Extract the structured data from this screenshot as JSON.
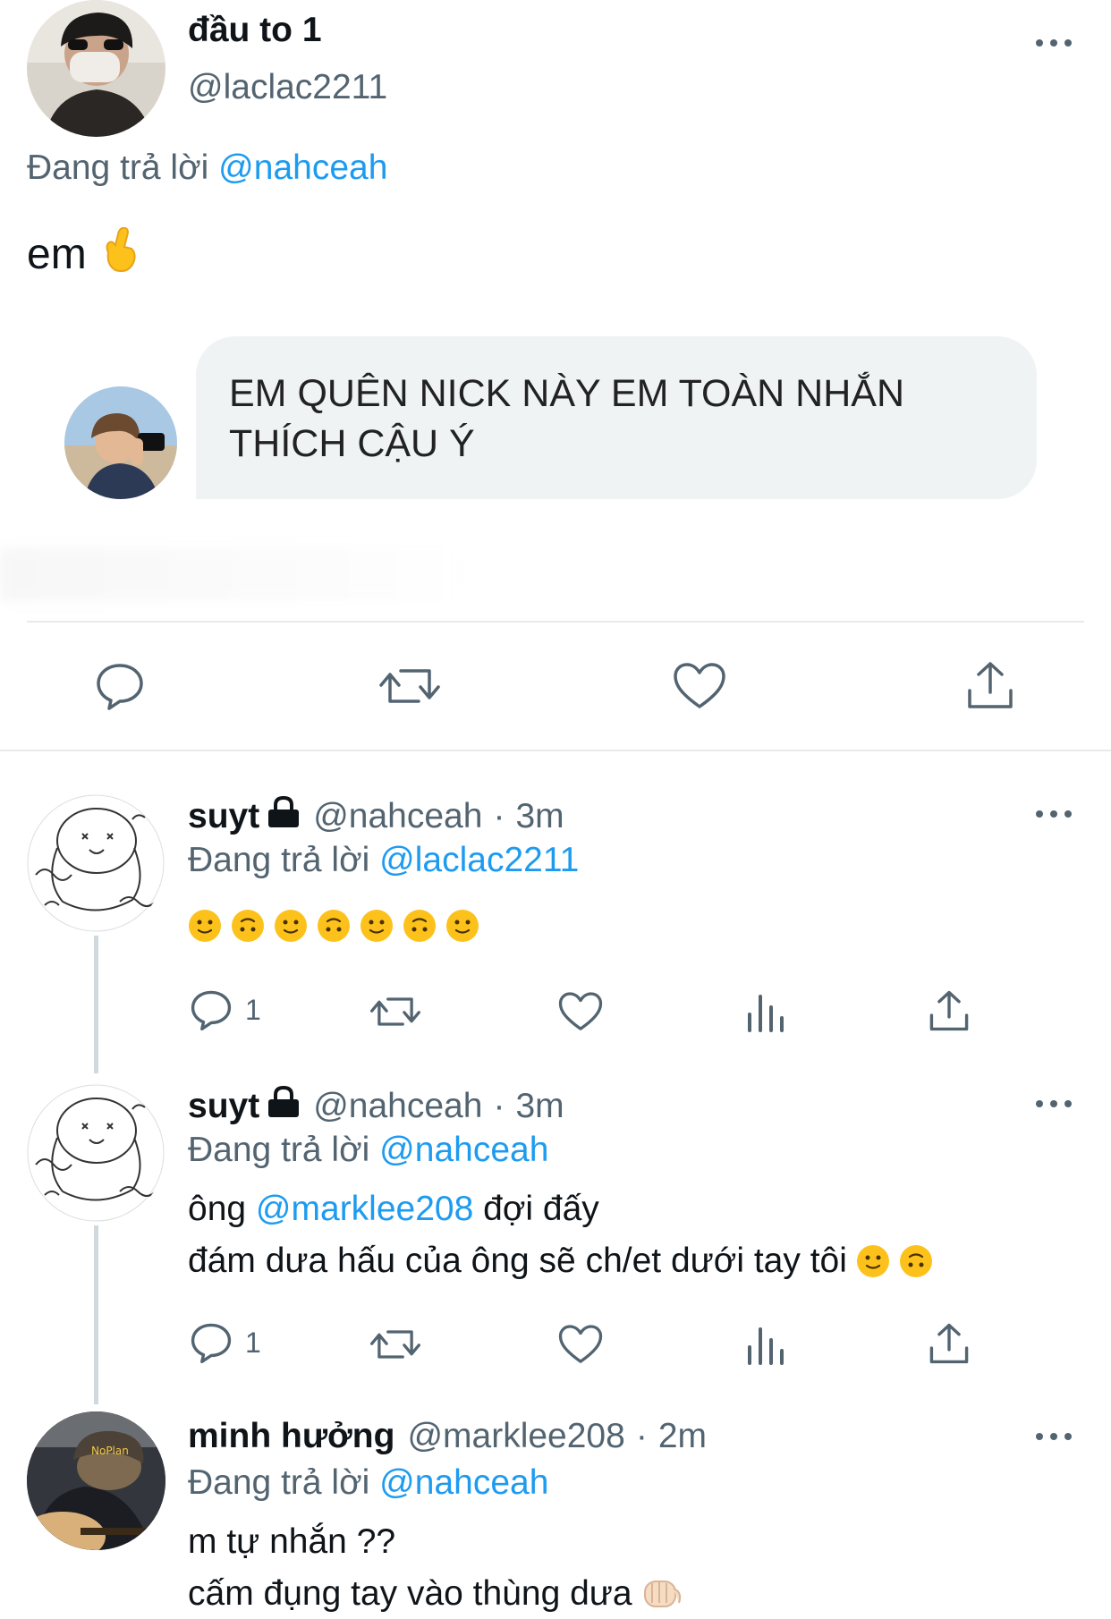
{
  "main_tweet": {
    "name": "đầu to 1",
    "handle": "@laclac2211",
    "reply_prefix": "Đang trả lời",
    "reply_to": "@nahceah",
    "text": "em",
    "text_emoji": "crossed-fingers-emoji",
    "more_icon": "more-icon"
  },
  "dm_bubble": {
    "text": "EM QUÊN NICK NÀY EM TOÀN NHẮN THÍCH CẬU Ý"
  },
  "main_actions": [
    "reply-icon",
    "retweet-icon",
    "like-icon",
    "share-icon"
  ],
  "replies": [
    {
      "name": "suyt",
      "protected": true,
      "handle": "@nahceah",
      "sep": "·",
      "time": "3m",
      "reply_prefix": "Đang trả lời",
      "reply_to": "@laclac2211",
      "emojis": [
        "slightly-smiling-face",
        "upside-down-face",
        "slightly-smiling-face",
        "upside-down-face",
        "slightly-smiling-face",
        "upside-down-face",
        "slightly-smiling-face"
      ],
      "reply_count": "1"
    },
    {
      "name": "suyt",
      "protected": true,
      "handle": "@nahceah",
      "sep": "·",
      "time": "3m",
      "reply_prefix": "Đang trả lời",
      "reply_to": "@nahceah",
      "line1_prefix": "ông",
      "line1_mention": "@marklee208",
      "line1_suffix": "đợi đấy",
      "line2": "đám dưa hấu của ông sẽ ch/et dưới tay tôi",
      "reply_count": "1"
    },
    {
      "name": "minh hưởng",
      "protected": false,
      "handle": "@marklee208",
      "sep": "·",
      "time": "2m",
      "reply_prefix": "Đang trả lời",
      "reply_to": "@nahceah",
      "line1": "m tự nhắn ??",
      "line2": "cấm đụng tay vào thùng dưa"
    }
  ],
  "colors": {
    "accent": "#1d9bf0",
    "muted": "#536471",
    "text": "#0f1419",
    "bubble": "#eff3f4",
    "emoji": "#fcc21b"
  }
}
